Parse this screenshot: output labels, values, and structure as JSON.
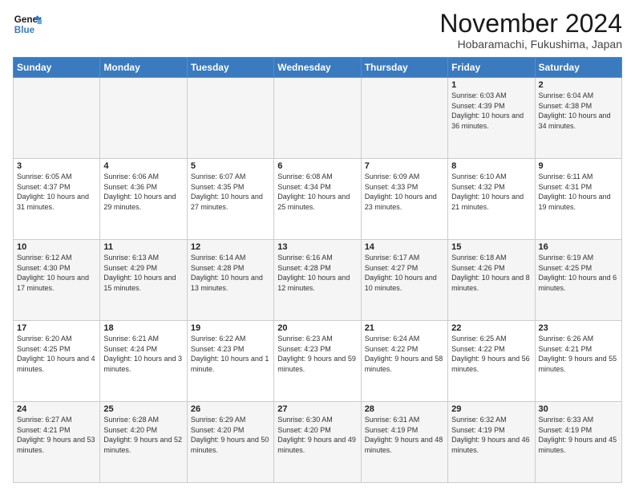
{
  "header": {
    "logo_general": "General",
    "logo_blue": "Blue",
    "month_title": "November 2024",
    "location": "Hobaramachi, Fukushima, Japan"
  },
  "days_of_week": [
    "Sunday",
    "Monday",
    "Tuesday",
    "Wednesday",
    "Thursday",
    "Friday",
    "Saturday"
  ],
  "weeks": [
    [
      {
        "day": "",
        "info": ""
      },
      {
        "day": "",
        "info": ""
      },
      {
        "day": "",
        "info": ""
      },
      {
        "day": "",
        "info": ""
      },
      {
        "day": "",
        "info": ""
      },
      {
        "day": "1",
        "info": "Sunrise: 6:03 AM\nSunset: 4:39 PM\nDaylight: 10 hours and 36 minutes."
      },
      {
        "day": "2",
        "info": "Sunrise: 6:04 AM\nSunset: 4:38 PM\nDaylight: 10 hours and 34 minutes."
      }
    ],
    [
      {
        "day": "3",
        "info": "Sunrise: 6:05 AM\nSunset: 4:37 PM\nDaylight: 10 hours and 31 minutes."
      },
      {
        "day": "4",
        "info": "Sunrise: 6:06 AM\nSunset: 4:36 PM\nDaylight: 10 hours and 29 minutes."
      },
      {
        "day": "5",
        "info": "Sunrise: 6:07 AM\nSunset: 4:35 PM\nDaylight: 10 hours and 27 minutes."
      },
      {
        "day": "6",
        "info": "Sunrise: 6:08 AM\nSunset: 4:34 PM\nDaylight: 10 hours and 25 minutes."
      },
      {
        "day": "7",
        "info": "Sunrise: 6:09 AM\nSunset: 4:33 PM\nDaylight: 10 hours and 23 minutes."
      },
      {
        "day": "8",
        "info": "Sunrise: 6:10 AM\nSunset: 4:32 PM\nDaylight: 10 hours and 21 minutes."
      },
      {
        "day": "9",
        "info": "Sunrise: 6:11 AM\nSunset: 4:31 PM\nDaylight: 10 hours and 19 minutes."
      }
    ],
    [
      {
        "day": "10",
        "info": "Sunrise: 6:12 AM\nSunset: 4:30 PM\nDaylight: 10 hours and 17 minutes."
      },
      {
        "day": "11",
        "info": "Sunrise: 6:13 AM\nSunset: 4:29 PM\nDaylight: 10 hours and 15 minutes."
      },
      {
        "day": "12",
        "info": "Sunrise: 6:14 AM\nSunset: 4:28 PM\nDaylight: 10 hours and 13 minutes."
      },
      {
        "day": "13",
        "info": "Sunrise: 6:16 AM\nSunset: 4:28 PM\nDaylight: 10 hours and 12 minutes."
      },
      {
        "day": "14",
        "info": "Sunrise: 6:17 AM\nSunset: 4:27 PM\nDaylight: 10 hours and 10 minutes."
      },
      {
        "day": "15",
        "info": "Sunrise: 6:18 AM\nSunset: 4:26 PM\nDaylight: 10 hours and 8 minutes."
      },
      {
        "day": "16",
        "info": "Sunrise: 6:19 AM\nSunset: 4:25 PM\nDaylight: 10 hours and 6 minutes."
      }
    ],
    [
      {
        "day": "17",
        "info": "Sunrise: 6:20 AM\nSunset: 4:25 PM\nDaylight: 10 hours and 4 minutes."
      },
      {
        "day": "18",
        "info": "Sunrise: 6:21 AM\nSunset: 4:24 PM\nDaylight: 10 hours and 3 minutes."
      },
      {
        "day": "19",
        "info": "Sunrise: 6:22 AM\nSunset: 4:23 PM\nDaylight: 10 hours and 1 minute."
      },
      {
        "day": "20",
        "info": "Sunrise: 6:23 AM\nSunset: 4:23 PM\nDaylight: 9 hours and 59 minutes."
      },
      {
        "day": "21",
        "info": "Sunrise: 6:24 AM\nSunset: 4:22 PM\nDaylight: 9 hours and 58 minutes."
      },
      {
        "day": "22",
        "info": "Sunrise: 6:25 AM\nSunset: 4:22 PM\nDaylight: 9 hours and 56 minutes."
      },
      {
        "day": "23",
        "info": "Sunrise: 6:26 AM\nSunset: 4:21 PM\nDaylight: 9 hours and 55 minutes."
      }
    ],
    [
      {
        "day": "24",
        "info": "Sunrise: 6:27 AM\nSunset: 4:21 PM\nDaylight: 9 hours and 53 minutes."
      },
      {
        "day": "25",
        "info": "Sunrise: 6:28 AM\nSunset: 4:20 PM\nDaylight: 9 hours and 52 minutes."
      },
      {
        "day": "26",
        "info": "Sunrise: 6:29 AM\nSunset: 4:20 PM\nDaylight: 9 hours and 50 minutes."
      },
      {
        "day": "27",
        "info": "Sunrise: 6:30 AM\nSunset: 4:20 PM\nDaylight: 9 hours and 49 minutes."
      },
      {
        "day": "28",
        "info": "Sunrise: 6:31 AM\nSunset: 4:19 PM\nDaylight: 9 hours and 48 minutes."
      },
      {
        "day": "29",
        "info": "Sunrise: 6:32 AM\nSunset: 4:19 PM\nDaylight: 9 hours and 46 minutes."
      },
      {
        "day": "30",
        "info": "Sunrise: 6:33 AM\nSunset: 4:19 PM\nDaylight: 9 hours and 45 minutes."
      }
    ]
  ]
}
